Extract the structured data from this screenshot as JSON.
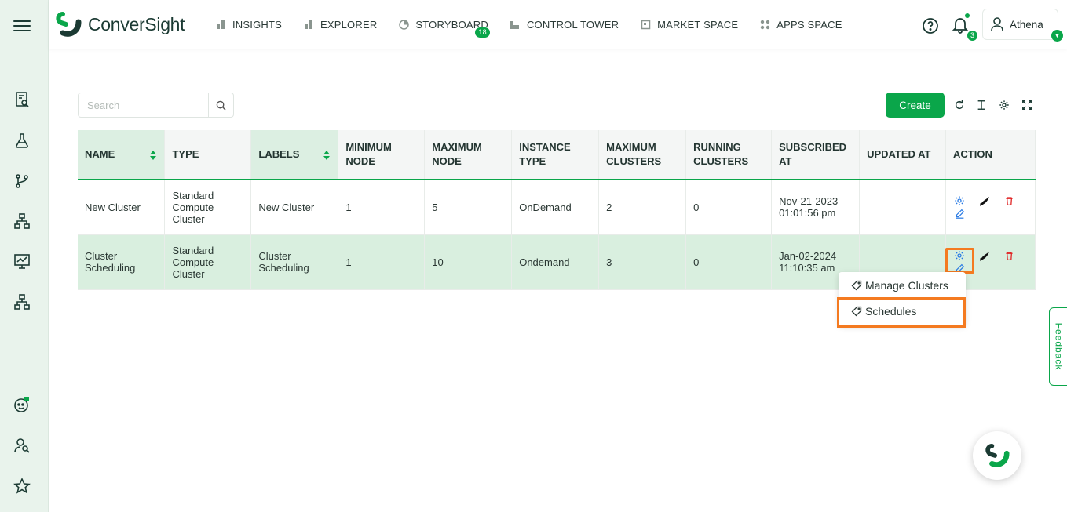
{
  "app": {
    "logo_text": "ConverSight"
  },
  "nav": {
    "items": [
      {
        "label": "INSIGHTS",
        "icon": "bar-chart-icon"
      },
      {
        "label": "EXPLORER",
        "icon": "bar-chart-icon"
      },
      {
        "label": "STORYBOARD",
        "icon": "pie-chart-icon",
        "badge": "18"
      },
      {
        "label": "CONTROL TOWER",
        "icon": "tower-icon"
      },
      {
        "label": "MARKET SPACE",
        "icon": "store-icon"
      },
      {
        "label": "APPS SPACE",
        "icon": "apps-grid-icon"
      }
    ]
  },
  "header": {
    "notification_count": "3",
    "user_name": "Athena"
  },
  "toolbar": {
    "search_placeholder": "Search",
    "create_label": "Create"
  },
  "table": {
    "columns": [
      {
        "label": "NAME",
        "sorted": true
      },
      {
        "label": "TYPE",
        "sorted": false
      },
      {
        "label": "LABELS",
        "sorted": true
      },
      {
        "label": "MINIMUM NODE",
        "sorted": false
      },
      {
        "label": "MAXIMUM NODE",
        "sorted": false
      },
      {
        "label": "INSTANCE TYPE",
        "sorted": false
      },
      {
        "label": "MAXIMUM CLUSTERS",
        "sorted": false
      },
      {
        "label": "RUNNING CLUSTERS",
        "sorted": false
      },
      {
        "label": "SUBSCRIBED AT",
        "sorted": false
      },
      {
        "label": "UPDATED AT",
        "sorted": false
      },
      {
        "label": "ACTION",
        "sorted": false
      }
    ],
    "rows": [
      {
        "name": "New Cluster",
        "type": "Standard Compute Cluster",
        "labels": "New Cluster",
        "min_node": "1",
        "max_node": "5",
        "instance_type": "OnDemand",
        "max_clusters": "2",
        "running_clusters": "0",
        "subscribed_at": "Nov-21-2023 01:01:56 pm",
        "updated_at": ""
      },
      {
        "name": "Cluster Scheduling",
        "type": "Standard Compute Cluster",
        "labels": "Cluster Scheduling",
        "min_node": "1",
        "max_node": "10",
        "instance_type": "Ondemand",
        "max_clusters": "3",
        "running_clusters": "0",
        "subscribed_at": "Jan-02-2024 11:10:35 am",
        "updated_at": ""
      }
    ]
  },
  "dropdown": {
    "items": [
      {
        "label": "Manage Clusters",
        "icon": "tag-icon"
      },
      {
        "label": "Schedules",
        "icon": "tag-icon"
      }
    ]
  },
  "feedback_label": "Feedback",
  "colors": {
    "accent": "#0aa64a",
    "highlight": "#f47a20",
    "selected_row": "#d9efdf",
    "sidebar_bg": "#e9f3ec"
  }
}
